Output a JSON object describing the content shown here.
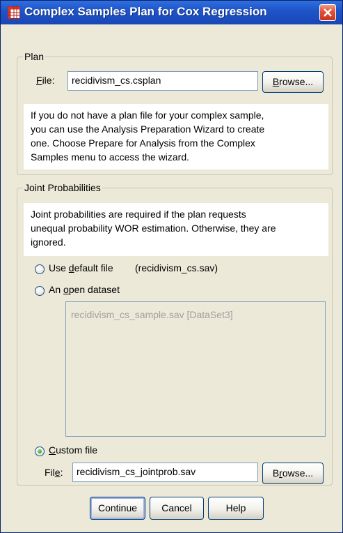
{
  "window": {
    "title": "Complex Samples Plan for Cox Regression"
  },
  "plan": {
    "group_label": "Plan",
    "file_label": "File:",
    "file_value": "recidivism_cs.csplan",
    "browse_label": "Browse...",
    "info_lines": [
      "If you do not have a plan file for your complex sample,",
      "you can use the Analysis Preparation Wizard to create",
      "one. Choose Prepare for Analysis from the Complex",
      "Samples menu to access the wizard."
    ]
  },
  "joint": {
    "group_label": "Joint Probabilities",
    "info_lines": [
      "Joint probabilities are required if the plan requests",
      "unequal probability WOR estimation. Otherwise, they are",
      "ignored."
    ],
    "option_default_label": "Use default file",
    "option_default_value": "(recidivism_cs.sav)",
    "option_open_label": "An open dataset",
    "open_datasets": [
      "recidivism_cs_sample.sav [DataSet3]"
    ],
    "option_custom_label": "Custom file",
    "selected_option": "custom",
    "custom_file_label": "File:",
    "custom_file_value": "recidivism_cs_jointprob.sav",
    "browse_label": "Browse..."
  },
  "buttons": {
    "continue": "Continue",
    "cancel": "Cancel",
    "help": "Help"
  },
  "icons": {
    "title": "table-grid-icon",
    "close": "close-icon"
  },
  "colors": {
    "titlebar": "#1f55c9",
    "close_button": "#e3543b",
    "dialog_background": "#ece9d8"
  }
}
